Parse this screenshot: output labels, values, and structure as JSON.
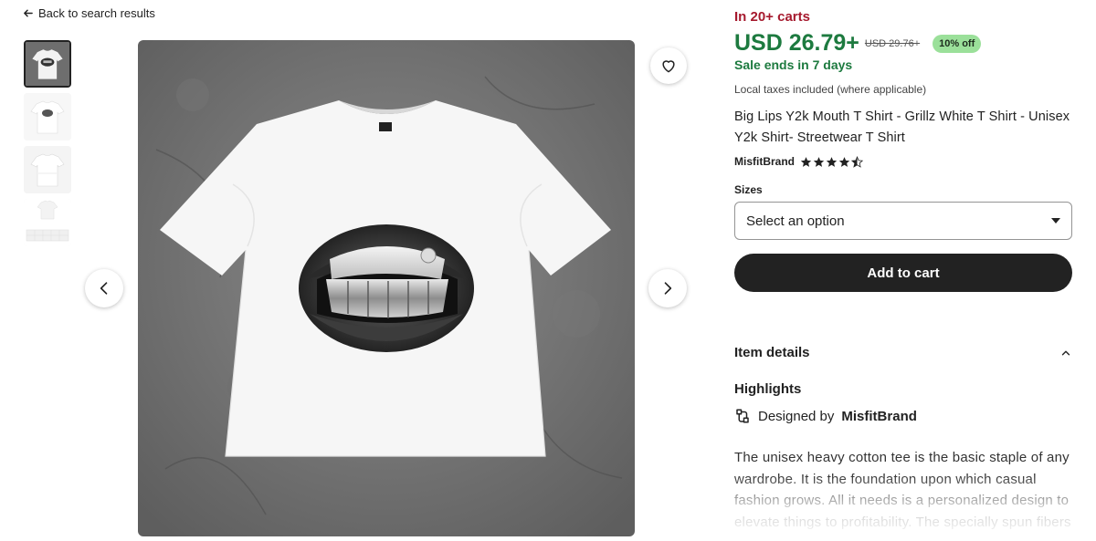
{
  "nav": {
    "back_label": "Back to search results"
  },
  "gallery": {
    "thumbnails": [
      "thumbnail-1",
      "thumbnail-2",
      "thumbnail-3",
      "thumbnail-4"
    ],
    "active_index": 0
  },
  "product": {
    "in_carts": "In 20+ carts",
    "price": "USD 26.79+",
    "original_price": "USD 29.76+",
    "discount": "10% off",
    "sale_ends": "Sale ends in 7 days",
    "taxes_note": "Local taxes included (where applicable)",
    "title": "Big Lips Y2k Mouth T Shirt - Grillz White T Shirt - Unisex Y2k Shirt- Streetwear T Shirt",
    "shop_name": "MisfitBrand",
    "rating": 4.5,
    "sizes_label": "Sizes",
    "sizes_placeholder": "Select an option",
    "add_to_cart": "Add to cart"
  },
  "details": {
    "section_title": "Item details",
    "highlights_title": "Highlights",
    "designed_by_prefix": "Designed by",
    "designed_by_name": "MisfitBrand",
    "description": "The unisex heavy cotton tee is the basic staple of any wardrobe. It is the foundation upon which casual fashion grows. All it needs is a personalized design to elevate things to profitability. The specially spun fibers"
  },
  "colors": {
    "sale_green": "#1d7a3f",
    "carts_red": "#a61a2e",
    "discount_badge": "#9be09a",
    "button_dark": "#222222"
  },
  "icons": {
    "back": "arrow-left-icon",
    "favorite": "heart-icon",
    "prev": "chevron-left-icon",
    "next": "chevron-right-icon",
    "collapse": "chevron-up-icon",
    "designer": "designer-icon",
    "star": "star-icon"
  }
}
